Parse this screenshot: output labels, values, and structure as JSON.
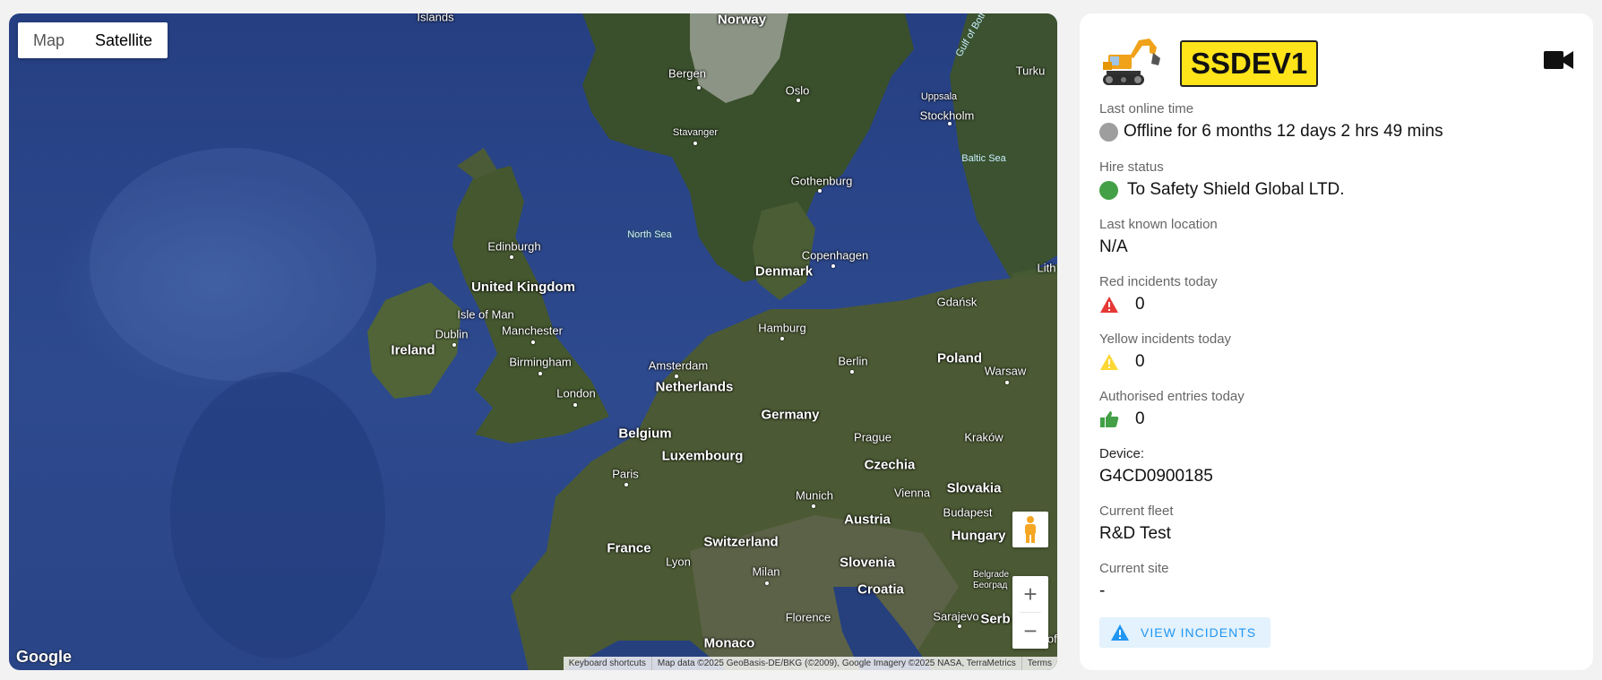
{
  "map": {
    "type_buttons": [
      {
        "label": "Map"
      },
      {
        "label": "Satellite"
      }
    ],
    "active_type": "Satellite",
    "google_logo": "Google",
    "attribution": {
      "shortcuts": "Keyboard shortcuts",
      "data": "Map data ©2025 GeoBasis-DE/BKG (©2009), Google Imagery ©2025 NASA, TerraMetrics",
      "terms": "Terms"
    },
    "zoom_in": "+",
    "zoom_out": "−",
    "labels": {
      "islands": "Islands",
      "norway": "Norway",
      "bergen": "Bergen",
      "oslo": "Oslo",
      "uppsala": "Uppsala",
      "stockholm": "Stockholm",
      "turku": "Turku",
      "stavanger": "Stavanger",
      "baltic_sea": "Baltic Sea",
      "gulf": "Gulf of Bothnia",
      "gothenburg": "Gothenburg",
      "north_sea": "North Sea",
      "edinburgh": "Edinburgh",
      "united_kingdom": "United Kingdom",
      "copenhagen": "Copenhagen",
      "denmark": "Denmark",
      "lith": "Lith",
      "gdansk": "Gdańsk",
      "isle_of_man": "Isle of Man",
      "dublin": "Dublin",
      "manchester": "Manchester",
      "ireland": "Ireland",
      "hamburg": "Hamburg",
      "birmingham": "Birmingham",
      "amsterdam": "Amsterdam",
      "berlin": "Berlin",
      "poland": "Poland",
      "warsaw": "Warsaw",
      "netherlands": "Netherlands",
      "london": "London",
      "germany": "Germany",
      "belgium": "Belgium",
      "prague": "Prague",
      "krakow": "Kraków",
      "luxembourg": "Luxembourg",
      "czechia": "Czechia",
      "paris": "Paris",
      "slovakia": "Slovakia",
      "munich": "Munich",
      "vienna": "Vienna",
      "budapest": "Budapest",
      "austria": "Austria",
      "switzerland": "Switzerland",
      "hungary": "Hungary",
      "france": "France",
      "lyon": "Lyon",
      "milan": "Milan",
      "slovenia": "Slovenia",
      "belgrade": "Belgrade Београд",
      "croatia": "Croatia",
      "florence": "Florence",
      "sarajevo": "Sarajevo",
      "serb": "Serb",
      "monaco": "Monaco",
      "sof": "Sof"
    }
  },
  "vehicle": {
    "registration": "SSDEV1",
    "last_online": {
      "label": "Last online time",
      "value": "Offline for 6 months 12 days 2 hrs 49 mins",
      "color": "#9e9e9e"
    },
    "hire_status": {
      "label": "Hire status",
      "value": "To Safety Shield Global LTD.",
      "color": "#43a047"
    },
    "location": {
      "label": "Last known location",
      "value": "N/A"
    },
    "red_incidents": {
      "label": "Red incidents today",
      "value": "0",
      "color": "#e53935"
    },
    "yellow_incidents": {
      "label": "Yellow incidents today",
      "value": "0",
      "color": "#fdd835"
    },
    "authorised_entries": {
      "label": "Authorised entries today",
      "value": "0",
      "color": "#43a047"
    },
    "device": {
      "label": "Device:",
      "value": "G4CD0900185"
    },
    "fleet": {
      "label": "Current fleet",
      "value": "R&D Test"
    },
    "site": {
      "label": "Current site",
      "value": "-"
    },
    "view_incidents": "VIEW INCIDENTS"
  }
}
